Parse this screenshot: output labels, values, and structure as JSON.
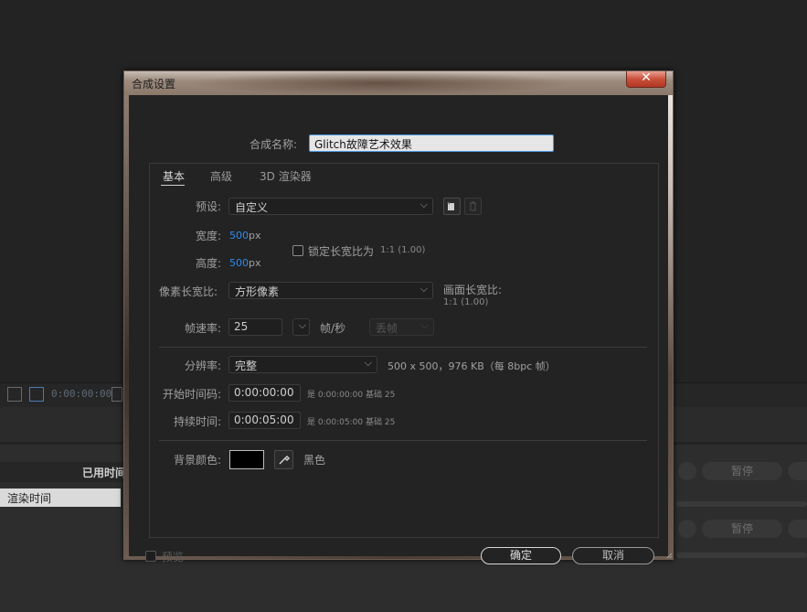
{
  "background_app": {
    "timecode": "0:00:00:00",
    "elapsed_time_label": "已用时间",
    "render_time_label": "渲染时间",
    "pause_label": "暂停"
  },
  "dialog": {
    "title": "合成设置",
    "close_symbol": "✕",
    "comp_name_label": "合成名称:",
    "comp_name_value": "Glitch故障艺术效果",
    "tabs": [
      "基本",
      "高级",
      "3D 渲染器"
    ],
    "preset_label": "预设:",
    "preset_value": "自定义",
    "width_label": "宽度:",
    "width_value": "500",
    "width_unit": "px",
    "height_label": "高度:",
    "height_value": "500",
    "height_unit": "px",
    "lock_aspect_label": "锁定长宽比为",
    "lock_aspect_value": "1:1 (1.00)",
    "pixel_aspect_label": "像素长宽比:",
    "pixel_aspect_value": "方形像素",
    "frame_aspect_label": "画面长宽比:",
    "frame_aspect_value": "1:1 (1.00)",
    "frame_rate_label": "帧速率:",
    "frame_rate_value": "25",
    "frame_rate_unit": "帧/秒",
    "frame_drop_value": "丢帧",
    "resolution_label": "分辨率:",
    "resolution_value": "完整",
    "resolution_info": "500 x 500，976 KB（每 8bpc 帧）",
    "start_tc_label": "开始时间码:",
    "start_tc_value": "0:00:00:00",
    "start_tc_note": "是 0:00:00:00",
    "start_tc_base": "基础 25",
    "duration_label": "持续时间:",
    "duration_value": "0:00:05:00",
    "duration_note": "是 0:00:05:00",
    "duration_base": "基础 25",
    "bg_color_label": "背景颜色:",
    "bg_color_name": "黑色",
    "bg_color_hex": "#000000",
    "preview_label": "预览",
    "ok_label": "确定",
    "cancel_label": "取消"
  },
  "colors": {
    "accent": "#2d8ceb",
    "dialog_bg": "#232323",
    "close_button": "#c9503a"
  }
}
